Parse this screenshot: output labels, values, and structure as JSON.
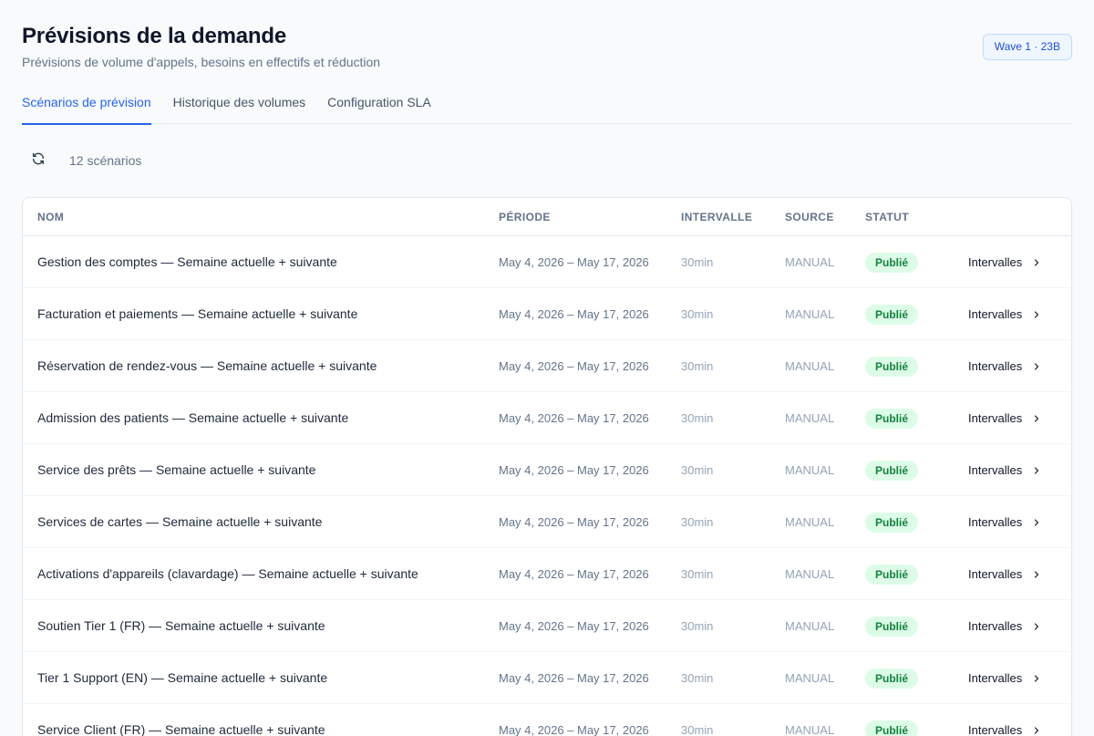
{
  "header": {
    "title": "Prévisions de la demande",
    "subtitle": "Prévisions de volume d'appels, besoins en effectifs et réduction",
    "badge": "Wave 1 · 23B"
  },
  "tabs": [
    {
      "label": "Scénarios de prévision",
      "active": true
    },
    {
      "label": "Historique des volumes",
      "active": false
    },
    {
      "label": "Configuration SLA",
      "active": false
    }
  ],
  "toolbar": {
    "refresh_icon": "refresh-icon",
    "count_label": "12 scénarios"
  },
  "table": {
    "columns": {
      "name": "NOM",
      "period": "PÉRIODE",
      "interval": "INTERVALLE",
      "source": "SOURCE",
      "status": "STATUT"
    },
    "rows": [
      {
        "name": "Gestion des comptes — Semaine actuelle + suivante",
        "period": "May 4, 2026 – May 17, 2026",
        "interval": "30min",
        "source": "MANUAL",
        "status": "Publié",
        "action": "Intervalles"
      },
      {
        "name": "Facturation et paiements — Semaine actuelle + suivante",
        "period": "May 4, 2026 – May 17, 2026",
        "interval": "30min",
        "source": "MANUAL",
        "status": "Publié",
        "action": "Intervalles"
      },
      {
        "name": "Réservation de rendez-vous — Semaine actuelle + suivante",
        "period": "May 4, 2026 – May 17, 2026",
        "interval": "30min",
        "source": "MANUAL",
        "status": "Publié",
        "action": "Intervalles"
      },
      {
        "name": "Admission des patients — Semaine actuelle + suivante",
        "period": "May 4, 2026 – May 17, 2026",
        "interval": "30min",
        "source": "MANUAL",
        "status": "Publié",
        "action": "Intervalles"
      },
      {
        "name": "Service des prêts — Semaine actuelle + suivante",
        "period": "May 4, 2026 – May 17, 2026",
        "interval": "30min",
        "source": "MANUAL",
        "status": "Publié",
        "action": "Intervalles"
      },
      {
        "name": "Services de cartes — Semaine actuelle + suivante",
        "period": "May 4, 2026 – May 17, 2026",
        "interval": "30min",
        "source": "MANUAL",
        "status": "Publié",
        "action": "Intervalles"
      },
      {
        "name": "Activations d'appareils (clavardage) — Semaine actuelle + suivante",
        "period": "May 4, 2026 – May 17, 2026",
        "interval": "30min",
        "source": "MANUAL",
        "status": "Publié",
        "action": "Intervalles"
      },
      {
        "name": "Soutien Tier 1 (FR) — Semaine actuelle + suivante",
        "period": "May 4, 2026 – May 17, 2026",
        "interval": "30min",
        "source": "MANUAL",
        "status": "Publié",
        "action": "Intervalles"
      },
      {
        "name": "Tier 1 Support (EN) — Semaine actuelle + suivante",
        "period": "May 4, 2026 – May 17, 2026",
        "interval": "30min",
        "source": "MANUAL",
        "status": "Publié",
        "action": "Intervalles"
      },
      {
        "name": "Service Client (FR) — Semaine actuelle + suivante",
        "period": "May 4, 2026 – May 17, 2026",
        "interval": "30min",
        "source": "MANUAL",
        "status": "Publié",
        "action": "Intervalles"
      }
    ]
  },
  "colors": {
    "accent": "#2563eb",
    "status_bg": "#dcfce7",
    "status_fg": "#15803d"
  }
}
